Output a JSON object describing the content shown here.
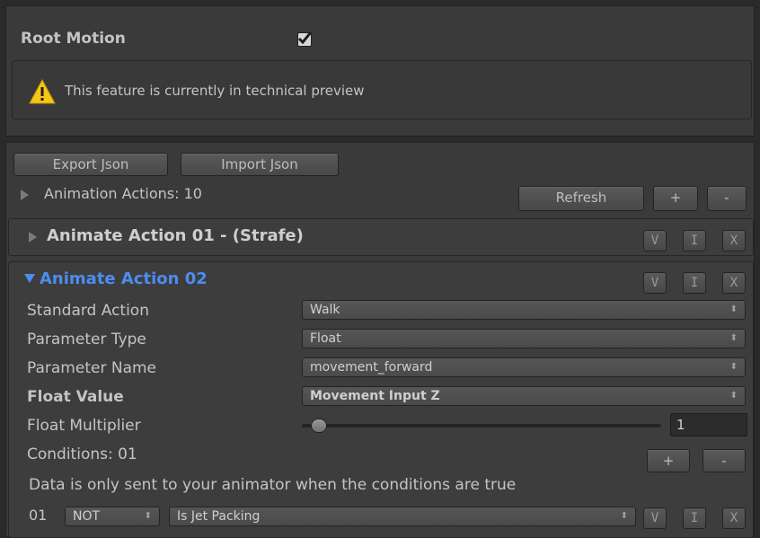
{
  "root_motion": {
    "label": "Root Motion",
    "checked": true
  },
  "warning": {
    "text": "This feature is currently in technical preview",
    "icon": "warning-icon"
  },
  "json_buttons": {
    "export": "Export Json",
    "import": "Import Json"
  },
  "actions_header": {
    "label": "Animation Actions: 10",
    "refresh": "Refresh",
    "add": "+",
    "remove": "-"
  },
  "action01": {
    "title": "Animate Action 01 - (Strafe)",
    "v": "V",
    "i": "I",
    "x": "X"
  },
  "action02": {
    "title": "Animate Action 02",
    "v": "V",
    "i": "I",
    "x": "X",
    "title_color": "#4d8cf0",
    "standard_action": {
      "label": "Standard Action",
      "value": "Walk"
    },
    "parameter_type": {
      "label": "Parameter Type",
      "value": "Float"
    },
    "parameter_name": {
      "label": "Parameter Name",
      "value": "movement_forward"
    },
    "float_value": {
      "label": "Float Value",
      "value": "Movement Input Z"
    },
    "float_multiplier": {
      "label": "Float Multiplier",
      "value": "1",
      "slider_fraction": 0.04
    },
    "conditions": {
      "label": "Conditions: 01",
      "add": "+",
      "remove": "-"
    },
    "info": "Data is only sent to your animator when the conditions are true",
    "condition_row": {
      "index": "01",
      "operator": "NOT",
      "condition": "Is Jet Packing",
      "v": "V",
      "i": "I",
      "x": "X"
    }
  },
  "dropdown_arrow": "⬍"
}
